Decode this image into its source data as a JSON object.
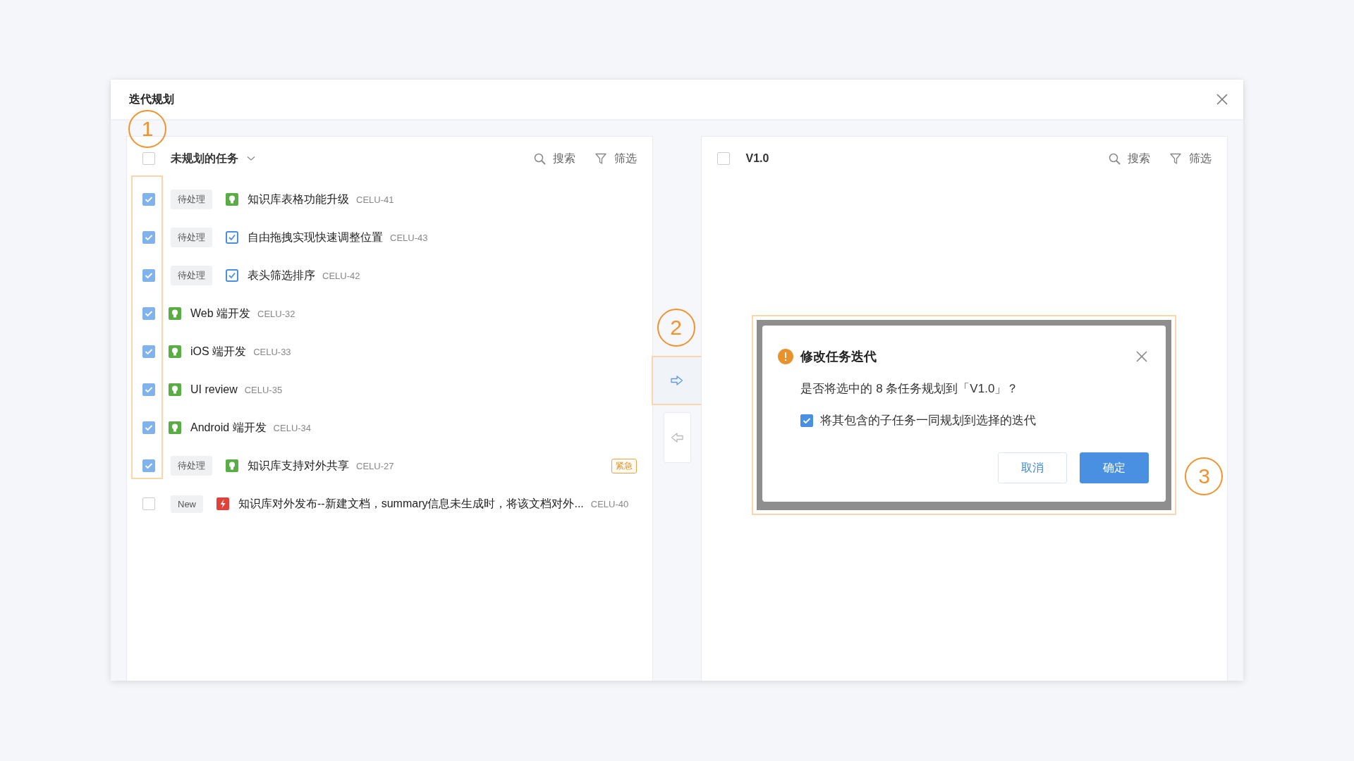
{
  "window": {
    "title": "迭代规划"
  },
  "annotations": [
    {
      "label": "1"
    },
    {
      "label": "2"
    },
    {
      "label": "3"
    }
  ],
  "left_panel": {
    "select_all": {
      "checked": false
    },
    "title": "未规划的任务",
    "search": "搜索",
    "filter": "筛选",
    "tasks": [
      {
        "checked": true,
        "status": "待处理",
        "kind": "idea",
        "title": "知识库表格功能升级",
        "code": "CELU-41"
      },
      {
        "checked": true,
        "status": "待处理",
        "kind": "task",
        "title": "自由拖拽实现快速调整位置",
        "code": "CELU-43"
      },
      {
        "checked": true,
        "status": "待处理",
        "kind": "task",
        "title": "表头筛选排序",
        "code": "CELU-42"
      },
      {
        "checked": true,
        "kind": "idea",
        "title": "Web 端开发",
        "code": "CELU-32"
      },
      {
        "checked": true,
        "kind": "idea",
        "title": "iOS 端开发",
        "code": "CELU-33"
      },
      {
        "checked": true,
        "kind": "idea",
        "title": "UI review",
        "code": "CELU-35"
      },
      {
        "checked": true,
        "kind": "idea",
        "title": "Android 端开发",
        "code": "CELU-34"
      },
      {
        "checked": true,
        "status": "待处理",
        "kind": "idea",
        "title": "知识库支持对外共享",
        "code": "CELU-27",
        "priority": "紧急"
      },
      {
        "checked": false,
        "status": "New",
        "kind": "bug",
        "title": "知识库对外发布--新建文档，summary信息未生成时，将该文档对外...",
        "code": "CELU-40"
      }
    ]
  },
  "right_panel": {
    "select_all": {
      "checked": false
    },
    "title": "V1.0",
    "search": "搜索",
    "filter": "筛选"
  },
  "dialog": {
    "title": "修改任务迭代",
    "message": "是否将选中的 8 条任务规划到「V1.0」？",
    "option": {
      "checked": true,
      "label": "将其包含的子任务一同规划到选择的迭代"
    },
    "buttons": [
      {
        "label": "取消",
        "kind": "secondary"
      },
      {
        "label": "确定",
        "kind": "primary"
      }
    ]
  }
}
